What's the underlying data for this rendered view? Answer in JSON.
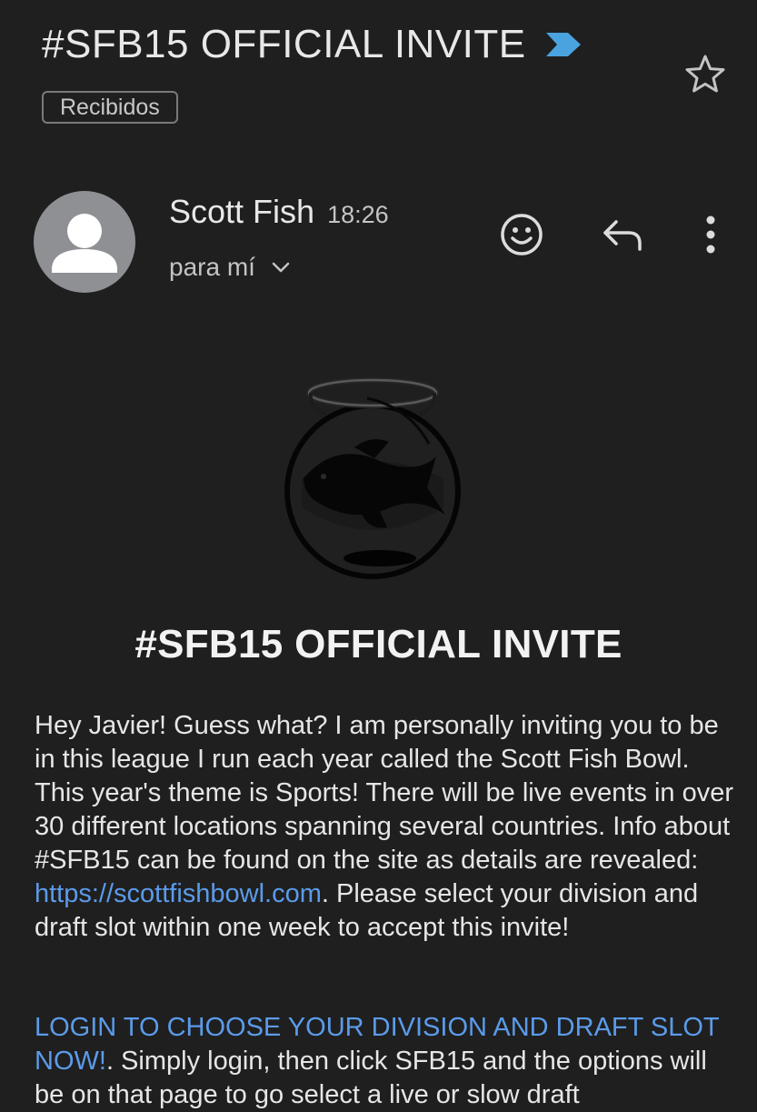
{
  "header": {
    "subject": "#SFB15 OFFICIAL INVITE",
    "label": "Recibidos",
    "importance_icon": "importance-marker-icon",
    "star_icon": "star-icon"
  },
  "message": {
    "sender_name": "Scott Fish",
    "time": "18:26",
    "recipient": "para mí",
    "actions": [
      "emoji-reaction-icon",
      "reply-icon",
      "more-vert-icon"
    ]
  },
  "body": {
    "title": "#SFB15 OFFICIAL INVITE",
    "p1_before": "Hey Javier! Guess what? I am personally inviting you to be in this league I run each year called the Scott Fish Bowl. This year's theme is Sports! There will be live events in over 30 different locations spanning several countries. Info about #SFB15 can be found on the site as details are revealed: ",
    "p1_link": "https://scottfishbowl.com",
    "p1_after": ". Please select your division and draft slot within one week to accept this invite!",
    "p2_link": "LOGIN TO CHOOSE YOUR DIVISION AND DRAFT SLOT NOW!",
    "p2_after": ". Simply login, then click SFB15 and the options will be on that page to go select a live or slow draft"
  },
  "colors": {
    "background": "#1f1f1f",
    "link": "#5b9bea",
    "importance": "#4aa3df"
  }
}
